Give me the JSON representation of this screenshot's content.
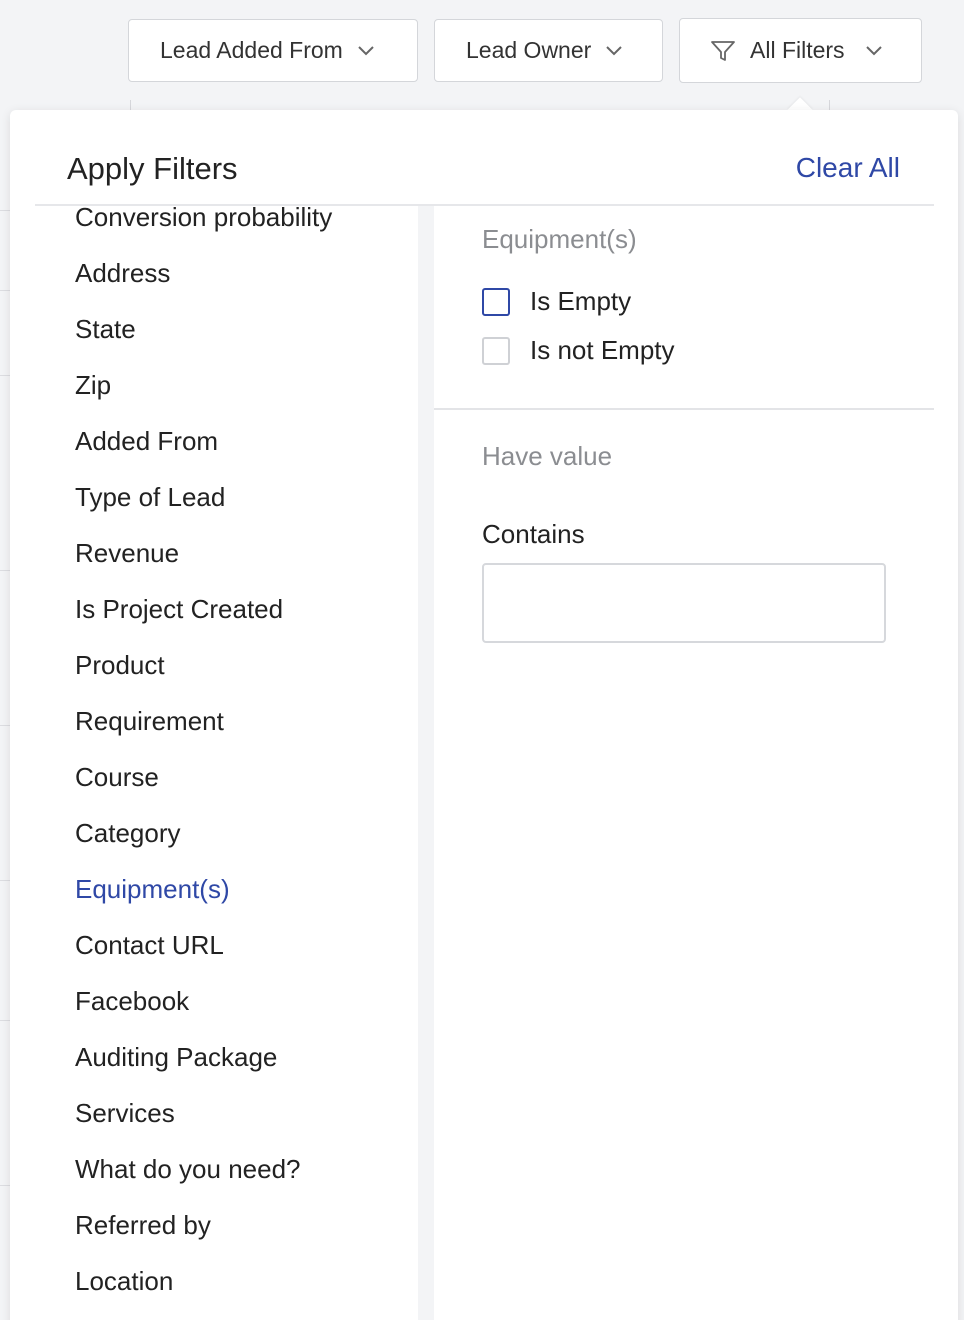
{
  "topbar": {
    "lead_added_from": "Lead Added From",
    "lead_owner": "Lead Owner",
    "all_filters": "All Filters"
  },
  "panel": {
    "title": "Apply Filters",
    "clear_all": "Clear All"
  },
  "fields": [
    "Conversion probability",
    "Address",
    "State",
    "Zip",
    "Added From",
    "Type of Lead",
    "Revenue",
    "Is Project Created",
    "Product",
    "Requirement",
    "Course",
    "Category",
    "Equipment(s)",
    "Contact URL",
    "Facebook",
    "Auditing Package",
    "Services",
    "What do you need?",
    "Referred by",
    "Location"
  ],
  "active_field": "Equipment(s)",
  "detail": {
    "section_title": "Equipment(s)",
    "options": {
      "is_empty": "Is Empty",
      "is_not_empty": "Is not Empty"
    },
    "value_section_title": "Have value",
    "contains_label": "Contains",
    "contains_value": ""
  },
  "colors": {
    "accent": "#2f48a6",
    "muted": "#8b8d91"
  }
}
